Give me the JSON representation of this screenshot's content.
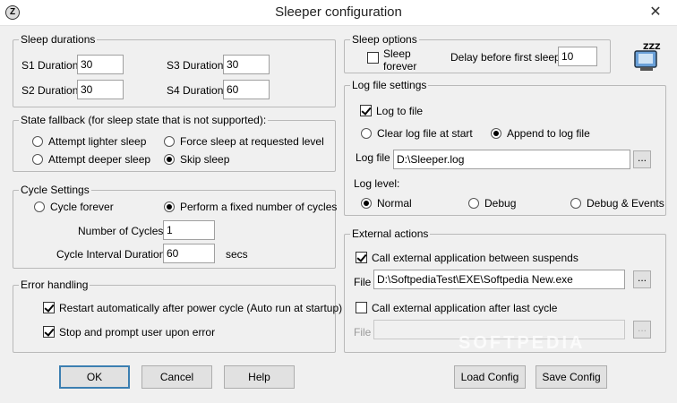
{
  "window": {
    "title": "Sleeper configuration",
    "close_glyph": "✕",
    "app_icon_glyph": "Z"
  },
  "sleep_durations": {
    "legend": "Sleep durations",
    "s1_label": "S1 Duration",
    "s1_value": "30",
    "s2_label": "S2 Duration",
    "s2_value": "30",
    "s3_label": "S3 Duration",
    "s3_value": "30",
    "s4_label": "S4 Duration",
    "s4_value": "60"
  },
  "state_fallback": {
    "legend": "State fallback (for sleep state that is not supported):",
    "attempt_lighter": "Attempt lighter sleep",
    "force_sleep": "Force sleep at requested level",
    "attempt_deeper": "Attempt deeper sleep",
    "skip_sleep": "Skip sleep",
    "selected": "skip_sleep"
  },
  "cycle_settings": {
    "legend": "Cycle Settings",
    "cycle_forever": "Cycle forever",
    "fixed_cycles": "Perform a fixed number of cycles",
    "selected": "fixed_cycles",
    "num_cycles_label": "Number of Cycles",
    "num_cycles_value": "1",
    "interval_label": "Cycle Interval Duration",
    "interval_value": "60",
    "interval_unit": "secs"
  },
  "error_handling": {
    "legend": "Error handling",
    "restart_label": "Restart automatically after power cycle (Auto run at startup)",
    "restart_checked": true,
    "stop_label": "Stop and prompt user upon error",
    "stop_checked": true
  },
  "sleep_options": {
    "legend": "Sleep options",
    "sleep_forever_line1": "Sleep",
    "sleep_forever_line2": "forever",
    "sleep_forever_checked": false,
    "delay_label": "Delay before first sleep",
    "delay_value": "10",
    "logo_text": "ZZZ"
  },
  "log_file_settings": {
    "legend": "Log file settings",
    "log_to_file": "Log to file",
    "log_to_file_checked": true,
    "clear_log": "Clear log file at start",
    "append_log": "Append to log file",
    "mode_selected": "append",
    "log_file_label": "Log file",
    "log_file_value": "D:\\Sleeper.log",
    "browse_label": "...",
    "log_level_label": "Log level:",
    "level_normal": "Normal",
    "level_debug": "Debug",
    "level_debug_events": "Debug & Events",
    "level_selected": "normal"
  },
  "external_actions": {
    "legend": "External actions",
    "call_between_label": "Call external application between suspends",
    "call_between_checked": true,
    "file_label": "File",
    "file_value": "D:\\SoftpediaTest\\EXE\\Softpedia New.exe",
    "browse_label": "...",
    "call_after_label": "Call external application after last cycle",
    "call_after_checked": false,
    "file2_label": "File",
    "file2_value": "",
    "browse2_label": "..."
  },
  "buttons": {
    "ok": "OK",
    "cancel": "Cancel",
    "help": "Help",
    "load_config": "Load Config",
    "save_config": "Save Config"
  },
  "watermark": "SOFTPEDIA"
}
